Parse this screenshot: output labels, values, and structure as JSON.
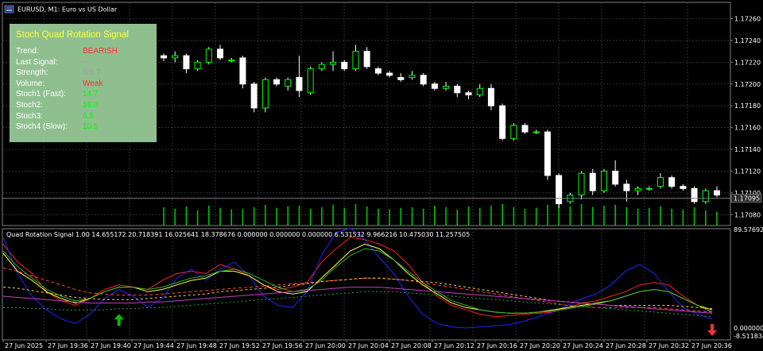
{
  "window": {
    "title": "EURUSD, M1:  Euro vs US Dollar",
    "icon": "chart-window-icon"
  },
  "colors": {
    "background": "#000000",
    "grid": "#3a4a3a",
    "candle_up_body": "#000000",
    "candle_up_border": "#00ff00",
    "candle_down_body": "#ffffff",
    "volume": "#00c000",
    "bid_line": "#808080",
    "bearish": "#ff3030",
    "stoch_value": "#00ff00",
    "muted": "#a0a0a0",
    "buy_arrow": "#00c000",
    "sell_arrow": "#ff3030"
  },
  "signal_panel": {
    "title": "Stoch Quad Rotation Signal",
    "rows": [
      {
        "label": "Trend:",
        "value": "BEARISH"
      },
      {
        "label": "Last Signal:",
        "value": "---"
      },
      {
        "label": "Strength:",
        "value": "0/5 ?"
      },
      {
        "label": "Volume:",
        "value": "Weak"
      },
      {
        "label": "Stoch1 (Fast):",
        "value": "14.7"
      },
      {
        "label": "Stoch2:",
        "value": "16.0"
      },
      {
        "label": "Stoch3:",
        "value": "6.5"
      },
      {
        "label": "Stoch4 (Slow):",
        "value": "10.5"
      }
    ]
  },
  "price_axis": {
    "labels": [
      "1.17260",
      "1.17240",
      "1.17220",
      "1.17200",
      "1.17180",
      "1.17160",
      "1.17140",
      "1.17120",
      "1.17100",
      "1.17080"
    ],
    "current_price": "1.17095",
    "range": [
      1.1707,
      1.17275
    ]
  },
  "indicator": {
    "title": "Quad Rotation Signal 1.00 14.655172 20.718391 16.025641 18.378676 0.000000 0.000000 0.000000 6.531532 9.966216 10.475030 11.257505",
    "axis_labels": [
      "89.576923",
      "0.000000",
      "-8.511834"
    ]
  },
  "time_axis": {
    "labels": [
      "27 Jun 2025",
      "27 Jun 19:36",
      "27 Jun 19:40",
      "27 Jun 19:44",
      "27 Jun 19:48",
      "27 Jun 19:52",
      "27 Jun 19:56",
      "27 Jun 20:00",
      "27 Jun 20:04",
      "27 Jun 20:08",
      "27 Jun 20:12",
      "27 Jun 20:16",
      "27 Jun 20:20",
      "27 Jun 20:24",
      "27 Jun 20:28",
      "27 Jun 20:32",
      "27 Jun 20:36"
    ]
  },
  "chart_data": {
    "type": "candlestick",
    "symbol": "EURUSD",
    "timeframe": "M1",
    "ylim": [
      1.1707,
      1.17275
    ],
    "candles": [
      {
        "o": 1.17226,
        "h": 1.17228,
        "l": 1.17221,
        "c": 1.17224
      },
      {
        "o": 1.17224,
        "h": 1.1723,
        "l": 1.1722,
        "c": 1.17226
      },
      {
        "o": 1.17226,
        "h": 1.17228,
        "l": 1.1721,
        "c": 1.17214
      },
      {
        "o": 1.17214,
        "h": 1.17222,
        "l": 1.17212,
        "c": 1.1722
      },
      {
        "o": 1.1722,
        "h": 1.17234,
        "l": 1.17218,
        "c": 1.17232
      },
      {
        "o": 1.17232,
        "h": 1.17236,
        "l": 1.17222,
        "c": 1.17224
      },
      {
        "o": 1.17222,
        "h": 1.17224,
        "l": 1.1722,
        "c": 1.17222
      },
      {
        "o": 1.17224,
        "h": 1.17226,
        "l": 1.17196,
        "c": 1.172
      },
      {
        "o": 1.172,
        "h": 1.17202,
        "l": 1.17174,
        "c": 1.17178
      },
      {
        "o": 1.17178,
        "h": 1.17206,
        "l": 1.17174,
        "c": 1.17204
      },
      {
        "o": 1.17204,
        "h": 1.17206,
        "l": 1.17198,
        "c": 1.172
      },
      {
        "o": 1.17198,
        "h": 1.17206,
        "l": 1.17194,
        "c": 1.17204
      },
      {
        "o": 1.17206,
        "h": 1.17226,
        "l": 1.17188,
        "c": 1.17194
      },
      {
        "o": 1.17192,
        "h": 1.17216,
        "l": 1.1719,
        "c": 1.17214
      },
      {
        "o": 1.17214,
        "h": 1.1722,
        "l": 1.17212,
        "c": 1.17218
      },
      {
        "o": 1.17218,
        "h": 1.1723,
        "l": 1.17212,
        "c": 1.1722
      },
      {
        "o": 1.1722,
        "h": 1.17222,
        "l": 1.17212,
        "c": 1.17214
      },
      {
        "o": 1.17214,
        "h": 1.17236,
        "l": 1.17212,
        "c": 1.1723
      },
      {
        "o": 1.1723,
        "h": 1.17234,
        "l": 1.17214,
        "c": 1.17216
      },
      {
        "o": 1.17214,
        "h": 1.17216,
        "l": 1.17208,
        "c": 1.1721
      },
      {
        "o": 1.1721,
        "h": 1.17212,
        "l": 1.17206,
        "c": 1.17208
      },
      {
        "o": 1.17206,
        "h": 1.1721,
        "l": 1.17202,
        "c": 1.17204
      },
      {
        "o": 1.17206,
        "h": 1.17212,
        "l": 1.17204,
        "c": 1.17208
      },
      {
        "o": 1.17208,
        "h": 1.1721,
        "l": 1.17198,
        "c": 1.172
      },
      {
        "o": 1.172,
        "h": 1.17202,
        "l": 1.17194,
        "c": 1.17196
      },
      {
        "o": 1.17196,
        "h": 1.17202,
        "l": 1.17194,
        "c": 1.17198
      },
      {
        "o": 1.17198,
        "h": 1.172,
        "l": 1.17188,
        "c": 1.17192
      },
      {
        "o": 1.17192,
        "h": 1.17194,
        "l": 1.17186,
        "c": 1.1719
      },
      {
        "o": 1.1719,
        "h": 1.172,
        "l": 1.17188,
        "c": 1.17196
      },
      {
        "o": 1.17196,
        "h": 1.172,
        "l": 1.17176,
        "c": 1.1718
      },
      {
        "o": 1.1718,
        "h": 1.17182,
        "l": 1.17148,
        "c": 1.1715
      },
      {
        "o": 1.1715,
        "h": 1.17164,
        "l": 1.17148,
        "c": 1.17162
      },
      {
        "o": 1.17162,
        "h": 1.17164,
        "l": 1.17154,
        "c": 1.17156
      },
      {
        "o": 1.17156,
        "h": 1.17158,
        "l": 1.17154,
        "c": 1.17156
      },
      {
        "o": 1.17156,
        "h": 1.17158,
        "l": 1.17112,
        "c": 1.17116
      },
      {
        "o": 1.17116,
        "h": 1.17118,
        "l": 1.17086,
        "c": 1.1709
      },
      {
        "o": 1.17092,
        "h": 1.171,
        "l": 1.1709,
        "c": 1.17098
      },
      {
        "o": 1.17098,
        "h": 1.1712,
        "l": 1.17094,
        "c": 1.17118
      },
      {
        "o": 1.17118,
        "h": 1.17122,
        "l": 1.17098,
        "c": 1.17102
      },
      {
        "o": 1.17102,
        "h": 1.17122,
        "l": 1.171,
        "c": 1.1712
      },
      {
        "o": 1.1712,
        "h": 1.1713,
        "l": 1.17106,
        "c": 1.17108
      },
      {
        "o": 1.17108,
        "h": 1.17112,
        "l": 1.17092,
        "c": 1.17102
      },
      {
        "o": 1.17102,
        "h": 1.17106,
        "l": 1.17098,
        "c": 1.17104
      },
      {
        "o": 1.17104,
        "h": 1.17106,
        "l": 1.17102,
        "c": 1.17104
      },
      {
        "o": 1.17106,
        "h": 1.17118,
        "l": 1.17104,
        "c": 1.17114
      },
      {
        "o": 1.17114,
        "h": 1.17116,
        "l": 1.17104,
        "c": 1.17106
      },
      {
        "o": 1.17106,
        "h": 1.17108,
        "l": 1.17102,
        "c": 1.17104
      },
      {
        "o": 1.17104,
        "h": 1.17106,
        "l": 1.1709,
        "c": 1.17092
      },
      {
        "o": 1.17092,
        "h": 1.17104,
        "l": 1.1709,
        "c": 1.17102
      },
      {
        "o": 1.17102,
        "h": 1.17106,
        "l": 1.17096,
        "c": 1.17098
      }
    ],
    "volumes": [
      24,
      22,
      25,
      20,
      26,
      23,
      21,
      22,
      24,
      27,
      23,
      25,
      26,
      22,
      24,
      27,
      23,
      28,
      25,
      22,
      21,
      23,
      24,
      22,
      26,
      24,
      21,
      25,
      23,
      26,
      28,
      24,
      22,
      23,
      27,
      29,
      25,
      28,
      24,
      26,
      27,
      24,
      22,
      23,
      25,
      22,
      21,
      24,
      20,
      18
    ],
    "indicator_ylim": [
      -8.511834,
      89.576923
    ],
    "stoch_series": [
      {
        "color": "#ff2020",
        "dash": "",
        "values": [
          76,
          60,
          50,
          34,
          26,
          22,
          28,
          36,
          40,
          38,
          36,
          44,
          50,
          52,
          50,
          58,
          54,
          48,
          40,
          36,
          38,
          42,
          60,
          72,
          82,
          80,
          76,
          70,
          58,
          42,
          30,
          22,
          18,
          14,
          12,
          13,
          14,
          15,
          16,
          20,
          24,
          26,
          30,
          34,
          40,
          42,
          40,
          30,
          22,
          16
        ]
      },
      {
        "color": "#2222ff",
        "dash": "",
        "values": [
          82,
          50,
          30,
          18,
          10,
          6,
          14,
          28,
          36,
          30,
          20,
          28,
          46,
          54,
          44,
          54,
          60,
          48,
          30,
          22,
          20,
          34,
          66,
          86,
          90,
          80,
          64,
          50,
          30,
          14,
          6,
          3,
          2,
          3,
          4,
          5,
          8,
          12,
          16,
          22,
          28,
          32,
          40,
          52,
          58,
          50,
          34,
          20,
          14,
          10
        ]
      },
      {
        "color": "#ffff40",
        "dash": "",
        "values": [
          68,
          52,
          44,
          34,
          28,
          24,
          28,
          34,
          38,
          38,
          34,
          36,
          40,
          44,
          46,
          52,
          52,
          48,
          40,
          34,
          32,
          34,
          46,
          58,
          70,
          76,
          72,
          62,
          50,
          40,
          32,
          24,
          20,
          18,
          16,
          15,
          15,
          16,
          18,
          20,
          22,
          24,
          26,
          30,
          34,
          36,
          34,
          28,
          22,
          18
        ]
      },
      {
        "color": "#30b030",
        "dash": "",
        "values": [
          70,
          56,
          46,
          36,
          30,
          26,
          28,
          34,
          38,
          38,
          36,
          38,
          42,
          46,
          48,
          52,
          54,
          50,
          44,
          38,
          34,
          36,
          44,
          56,
          66,
          72,
          70,
          62,
          52,
          42,
          34,
          26,
          22,
          18,
          16,
          15,
          15,
          16,
          17,
          19,
          21,
          23,
          26,
          30,
          34,
          36,
          34,
          28,
          22,
          16
        ]
      },
      {
        "color": "#ff4040",
        "dash": "4,3",
        "values": [
          55,
          52,
          48,
          44,
          40,
          36,
          33,
          32,
          31,
          31,
          31,
          32,
          33,
          34,
          35,
          36,
          37,
          38,
          39,
          40,
          41,
          42,
          43,
          44,
          45,
          46,
          46,
          45,
          44,
          42,
          40,
          38,
          36,
          34,
          32,
          30,
          28,
          26,
          24,
          22,
          21,
          20,
          20,
          20,
          20,
          20,
          19,
          18,
          17,
          16
        ]
      },
      {
        "color": "#ffcc33",
        "dash": "3,3",
        "values": [
          38,
          37,
          35,
          33,
          31,
          29,
          28,
          27,
          27,
          27,
          28,
          29,
          30,
          31,
          32,
          34,
          35,
          36,
          37,
          38,
          40,
          41,
          43,
          44,
          45,
          46,
          46,
          45,
          44,
          43,
          42,
          40,
          38,
          36,
          34,
          32,
          30,
          28,
          26,
          25,
          24,
          23,
          22,
          22,
          22,
          22,
          22,
          21,
          20,
          19
        ]
      },
      {
        "color": "#c040c0",
        "dash": "",
        "values": [
          30,
          29,
          28,
          27,
          26,
          25,
          24,
          24,
          24,
          24,
          25,
          25,
          26,
          27,
          28,
          29,
          30,
          31,
          32,
          33,
          34,
          35,
          36,
          37,
          38,
          38,
          38,
          37,
          36,
          35,
          34,
          33,
          32,
          31,
          30,
          29,
          28,
          27,
          26,
          25,
          24,
          23,
          22,
          21,
          20,
          19,
          18,
          17,
          16,
          15
        ]
      },
      {
        "color": "#30a040",
        "dash": "2,3",
        "values": [
          20,
          20,
          19,
          19,
          18,
          18,
          18,
          18,
          19,
          19,
          20,
          20,
          21,
          22,
          23,
          24,
          25,
          26,
          27,
          28,
          29,
          30,
          31,
          32,
          33,
          34,
          34,
          34,
          33,
          32,
          31,
          30,
          29,
          28,
          27,
          26,
          25,
          24,
          23,
          22,
          21,
          20,
          19,
          18,
          17,
          16,
          15,
          14,
          13,
          12
        ]
      }
    ],
    "signals": [
      {
        "type": "buy",
        "index": 8,
        "value": 6
      },
      {
        "type": "sell",
        "index": 49,
        "value": 2
      }
    ]
  }
}
